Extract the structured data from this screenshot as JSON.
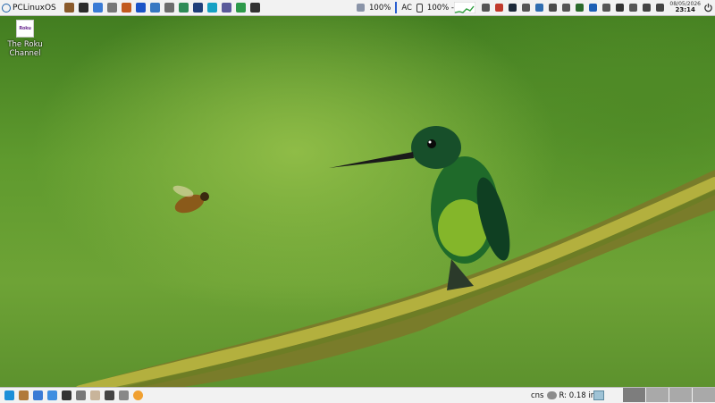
{
  "top_panel": {
    "menu_label": "PCLinuxOS",
    "launchers": [
      {
        "icon": "settings-icon",
        "color": "#8a5a2b"
      },
      {
        "icon": "terminal-icon",
        "color": "#2b2b2b"
      },
      {
        "icon": "text-editor-icon",
        "color": "#3a7bd5"
      },
      {
        "icon": "wrench-icon",
        "color": "#777777"
      },
      {
        "icon": "script-icon",
        "color": "#c25a1e"
      },
      {
        "icon": "browser-icon",
        "color": "#1a53c7"
      },
      {
        "icon": "calculator-icon",
        "color": "#3778c2"
      },
      {
        "icon": "spreadsheet-icon",
        "color": "#6c6c6c"
      },
      {
        "icon": "image-viewer-icon",
        "color": "#2e8b57"
      },
      {
        "icon": "monitor-icon",
        "color": "#1f3f7a"
      },
      {
        "icon": "network-icon",
        "color": "#16a1c4"
      },
      {
        "icon": "search-file-icon",
        "color": "#5a5a9a"
      },
      {
        "icon": "package-icon",
        "color": "#2e9a4a"
      },
      {
        "icon": "video-icon",
        "color": "#333333"
      }
    ],
    "battery": {
      "percent_label": "100%",
      "level": 1.0
    },
    "power_source": "AC",
    "charge_status": "100% - 0:00",
    "tray_icons": [
      "shield-icon",
      "flag-icon",
      "steam-icon",
      "settings-icon",
      "globe-icon",
      "chart-icon",
      "speaker-icon",
      "headset-icon",
      "bluetooth-icon",
      "wifi-icon",
      "terminal-icon",
      "clipboard-icon",
      "notes-icon",
      "volume-icon"
    ],
    "clock": {
      "date": "08/05/2026",
      "time": "23:14"
    }
  },
  "desktop": {
    "icons": [
      {
        "label": "The Roku Channel",
        "tile_text": "Roku"
      }
    ]
  },
  "bottom_panel": {
    "launchers": [
      "show-desktop-icon",
      "folder-icon",
      "browser-icon",
      "text-editor-icon",
      "terminal-icon",
      "gear-icon",
      "files-icon",
      "console-icon",
      "app-icon",
      "orange-icon"
    ],
    "weather_text": "cns",
    "rain_text": "R: 0.18 in",
    "workspaces": 4,
    "active_workspace": 1
  }
}
